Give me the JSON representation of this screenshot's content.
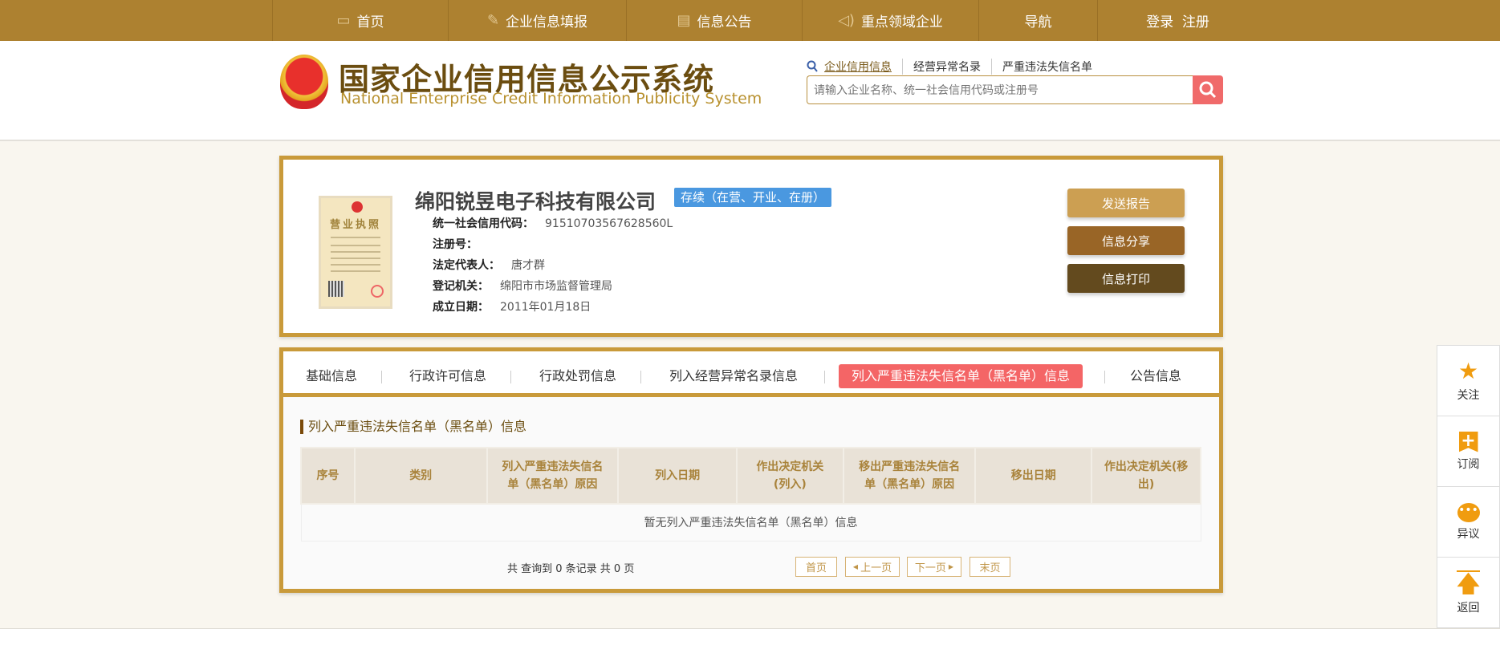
{
  "nav": [
    {
      "label": "首页",
      "icon": "monitor-icon"
    },
    {
      "label": "企业信息填报",
      "icon": "pen-icon"
    },
    {
      "label": "信息公告",
      "icon": "document-icon"
    },
    {
      "label": "重点领域企业",
      "icon": "speaker-icon"
    },
    {
      "label": "导航"
    },
    {
      "label": "登录  注册"
    }
  ],
  "logo": {
    "cn": "国家企业信用信息公示系统",
    "en": "National Enterprise Credit Information Publicity System"
  },
  "search": {
    "links": [
      "企业信用信息",
      "经营异常名录",
      "严重违法失信名单"
    ],
    "placeholder": "请输入企业名称、统一社会信用代码或注册号"
  },
  "license": {
    "title": "营业执照"
  },
  "company": {
    "name": "绵阳锐昱电子科技有限公司",
    "status": "存续（在营、开业、在册）",
    "fields": [
      {
        "label": "统一社会信用代码：",
        "value": "91510703567628560L"
      },
      {
        "label": "注册号：",
        "value": ""
      },
      {
        "label": "法定代表人：",
        "value": "唐才群"
      },
      {
        "label": "登记机关：",
        "value": "绵阳市市场监督管理局"
      },
      {
        "label": "成立日期：",
        "value": "2011年01月18日"
      }
    ]
  },
  "actions": {
    "report": "发送报告",
    "share": "信息分享",
    "print": "信息打印"
  },
  "tabs": [
    "基础信息",
    "行政许可信息",
    "行政处罚信息",
    "列入经营异常名录信息",
    "列入严重违法失信名单（黑名单）信息",
    "公告信息"
  ],
  "section": {
    "title": "列入严重违法失信名单（黑名单）信息",
    "columns": [
      "序号",
      "类别",
      "列入严重违法失信名单（黑名单）原因",
      "列入日期",
      "作出决定机关(列入)",
      "移出严重违法失信名单（黑名单）原因",
      "移出日期",
      "作出决定机关(移出)"
    ],
    "empty": "暂无列入严重违法失信名单（黑名单）信息"
  },
  "pagination": {
    "info": "共 查询到 0 条记录 共 0 页",
    "first": "首页",
    "prev": "上一页",
    "next": "下一页",
    "last": "末页"
  },
  "sidebar": [
    "关注",
    "订阅",
    "异议",
    "返回"
  ],
  "colors": {
    "nav": "#ad8130",
    "border": "#c99a3a",
    "active_tab": "#f46566",
    "badge": "#4a98e0"
  }
}
